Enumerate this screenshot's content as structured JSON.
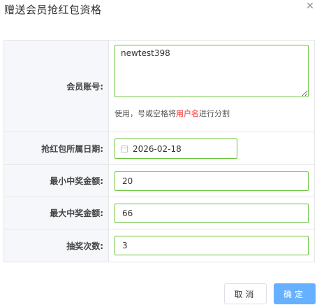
{
  "dialog": {
    "title": "赠送会员抢红包资格",
    "close_icon": "close-icon"
  },
  "form": {
    "member_account": {
      "label": "会员账号:",
      "value": "newtest398",
      "tip_prefix": "使用，号或空格将",
      "tip_highlight": "用户名",
      "tip_suffix": "进行分割"
    },
    "date": {
      "label": "抢红包所属日期:",
      "value": "2026-02-18",
      "icon": "calendar-icon"
    },
    "min_amount": {
      "label": "最小中奖金额:",
      "value": "20"
    },
    "max_amount": {
      "label": "最大中奖金额:",
      "value": "66"
    },
    "draw_count": {
      "label": "抽奖次数:",
      "value": "3"
    }
  },
  "buttons": {
    "cancel": "取消",
    "confirm": "确定"
  },
  "colors": {
    "focus_border": "#67c23a",
    "primary": "#66b1ff",
    "highlight": "#f56c6c"
  }
}
